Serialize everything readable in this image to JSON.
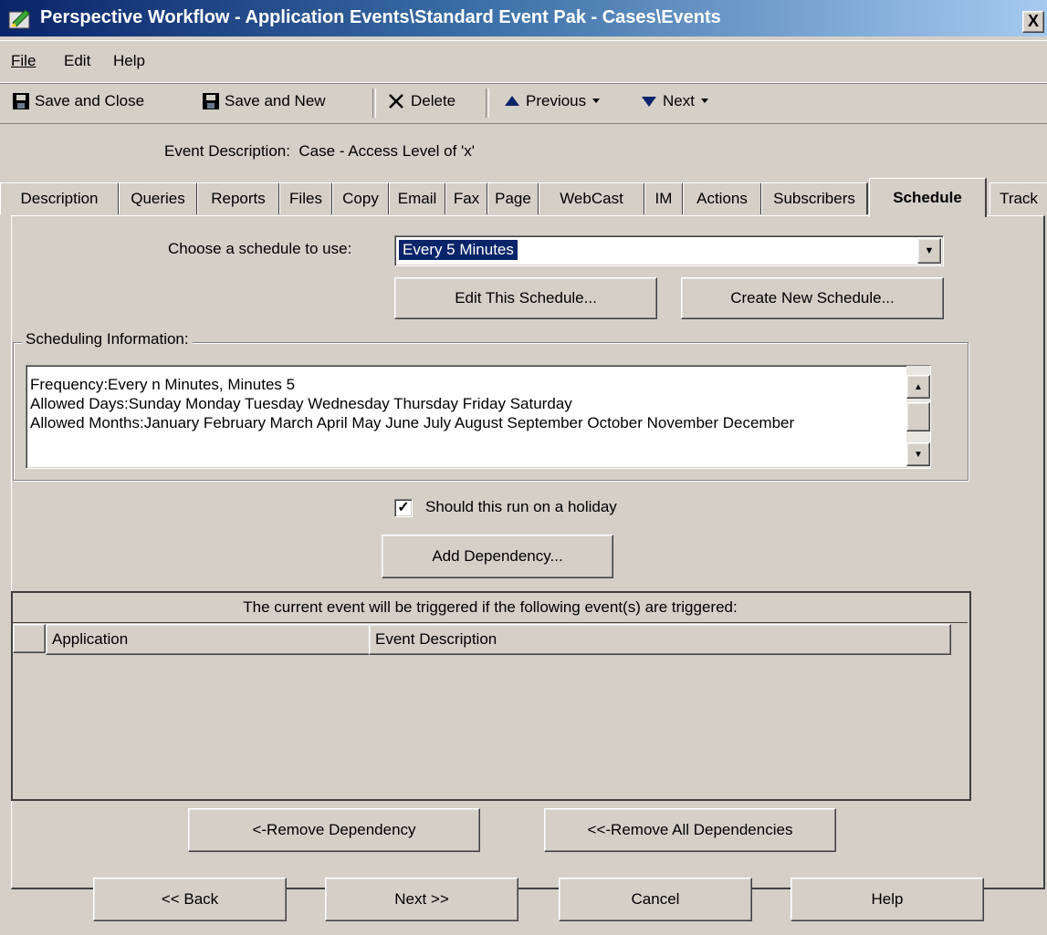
{
  "window": {
    "title": "Perspective Workflow - Application Events\\Standard Event Pak - Cases\\Events",
    "close_glyph": "X"
  },
  "menu": {
    "items": [
      "File",
      "Edit",
      "Help"
    ]
  },
  "toolbar": {
    "save_close": "Save and Close",
    "save_new": "Save and New",
    "delete": "Delete",
    "previous": "Previous",
    "next": "Next"
  },
  "event": {
    "label": "Event Description:",
    "value": "Case - Access Level of 'x'"
  },
  "tabs": [
    "Description",
    "Queries",
    "Reports",
    "Files",
    "Copy",
    "Email",
    "Fax",
    "Page",
    "WebCast",
    "IM",
    "Actions",
    "Subscribers",
    "Schedule",
    "Track"
  ],
  "schedule": {
    "choose_label": "Choose a schedule to use:",
    "selected": "Every 5 Minutes",
    "edit_button": "Edit This Schedule...",
    "create_button": "Create New Schedule...",
    "info_label": "Scheduling Information:",
    "info_lines": [
      "Frequency:Every n Minutes, Minutes 5",
      "Allowed Days:Sunday Monday Tuesday Wednesday Thursday Friday Saturday",
      "Allowed Months:January February March April May June July August September October November December"
    ],
    "holiday_label": "Should this run on a holiday",
    "holiday_checked": true,
    "add_dependency": "Add Dependency..."
  },
  "dependencies": {
    "caption": "The current event will be triggered if the following event(s) are triggered:",
    "columns": [
      "Application",
      "Event Description"
    ],
    "remove_button": "<-Remove Dependency",
    "remove_all_button": "<<-Remove All Dependencies"
  },
  "footer": {
    "back": "<< Back",
    "next": "Next >>",
    "cancel": "Cancel",
    "help": "Help"
  }
}
